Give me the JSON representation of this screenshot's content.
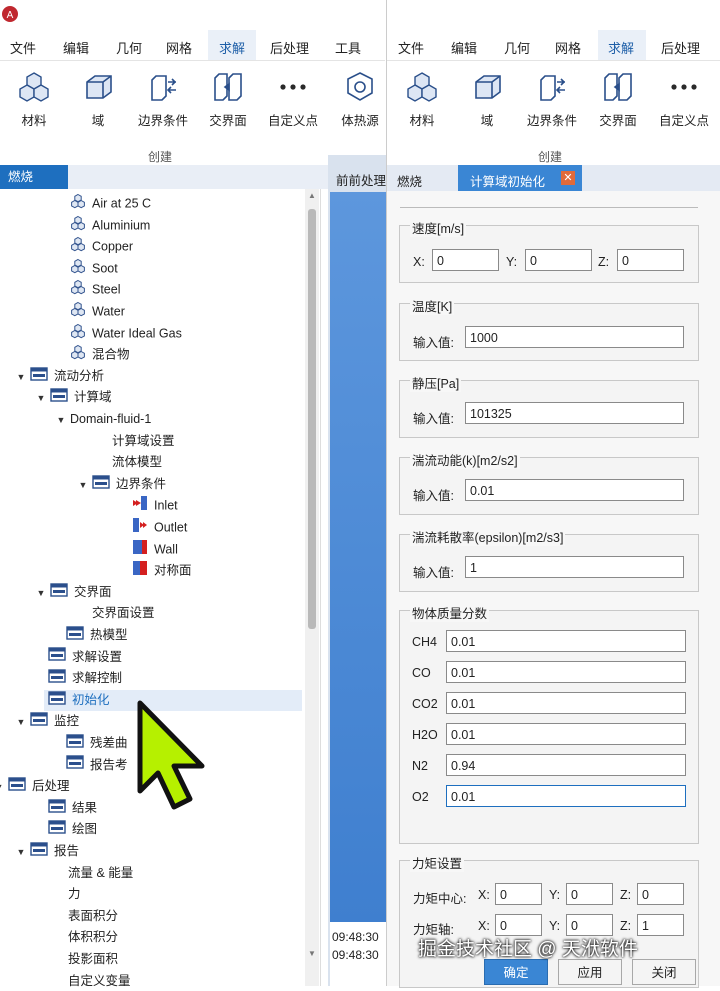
{
  "menu_left": [
    "文件",
    "编辑",
    "几何",
    "网格",
    "求解",
    "后处理",
    "工具"
  ],
  "menu_right": [
    "文件",
    "编辑",
    "几何",
    "网格",
    "求解",
    "后处理"
  ],
  "ribbon_left": [
    {
      "label": "材料",
      "icon": "materials-icon"
    },
    {
      "label": "域",
      "icon": "domain-icon"
    },
    {
      "label": "边界条件",
      "icon": "boundary-condition-icon"
    },
    {
      "label": "交界面",
      "icon": "interface-icon"
    },
    {
      "label": "自定义点",
      "icon": "custom-point-icon"
    },
    {
      "label": "体热源",
      "icon": "heat-source-icon"
    }
  ],
  "ribbon_right": [
    {
      "label": "材料",
      "icon": "materials-icon"
    },
    {
      "label": "域",
      "icon": "domain-icon"
    },
    {
      "label": "边界条件",
      "icon": "boundary-condition-icon"
    },
    {
      "label": "交界面",
      "icon": "interface-icon"
    },
    {
      "label": "自定义点",
      "icon": "custom-point-icon"
    }
  ],
  "group_label": "创建",
  "left_panel_tab": "燃烧",
  "middle_tab": "前前处理",
  "right_tabs": [
    "燃烧",
    "计算域初始化"
  ],
  "tree": [
    {
      "label": "Air at 25 C",
      "indent": 70,
      "icon": "material"
    },
    {
      "label": "Aluminium",
      "indent": 70,
      "icon": "material"
    },
    {
      "label": "Copper",
      "indent": 70,
      "icon": "material"
    },
    {
      "label": "Soot",
      "indent": 70,
      "icon": "material"
    },
    {
      "label": "Steel",
      "indent": 70,
      "icon": "material"
    },
    {
      "label": "Water",
      "indent": 70,
      "icon": "material"
    },
    {
      "label": "Water Ideal Gas",
      "indent": 70,
      "icon": "material"
    },
    {
      "label": "混合物",
      "indent": 70,
      "icon": "material"
    },
    {
      "label": "流动分析",
      "indent": 30,
      "icon": "folder",
      "arrow": "▼"
    },
    {
      "label": "计算域",
      "indent": 50,
      "icon": "folder",
      "arrow": "▼"
    },
    {
      "label": "Domain-fluid-1",
      "indent": 70,
      "icon": "none",
      "arrow": "▼"
    },
    {
      "label": "计算域设置",
      "indent": 112,
      "icon": "none"
    },
    {
      "label": "流体模型",
      "indent": 112,
      "icon": "none"
    },
    {
      "label": "边界条件",
      "indent": 92,
      "icon": "folder",
      "arrow": "▼"
    },
    {
      "label": "Inlet",
      "indent": 132,
      "icon": "inlet"
    },
    {
      "label": "Outlet",
      "indent": 132,
      "icon": "outlet"
    },
    {
      "label": "Wall",
      "indent": 132,
      "icon": "wall"
    },
    {
      "label": "对称面",
      "indent": 132,
      "icon": "symmetry"
    },
    {
      "label": "交界面",
      "indent": 50,
      "icon": "folder",
      "arrow": "▼"
    },
    {
      "label": "交界面设置",
      "indent": 92,
      "icon": "none"
    },
    {
      "label": "热模型",
      "indent": 66,
      "icon": "folder"
    },
    {
      "label": "求解设置",
      "indent": 48,
      "icon": "folder"
    },
    {
      "label": "求解控制",
      "indent": 48,
      "icon": "folder"
    },
    {
      "label": "初始化",
      "indent": 48,
      "icon": "folder",
      "selected": true
    },
    {
      "label": "监控",
      "indent": 30,
      "icon": "folder",
      "arrow": "▼"
    },
    {
      "label": "残差曲",
      "indent": 66,
      "icon": "folder"
    },
    {
      "label": "报告考",
      "indent": 66,
      "icon": "folder"
    },
    {
      "label": "后处理",
      "indent": 8,
      "icon": "folder",
      "arrow": "▼"
    },
    {
      "label": "结果",
      "indent": 48,
      "icon": "folder"
    },
    {
      "label": "绘图",
      "indent": 48,
      "icon": "folder"
    },
    {
      "label": "报告",
      "indent": 30,
      "icon": "folder",
      "arrow": "▼"
    },
    {
      "label": "流量 & 能量",
      "indent": 68,
      "icon": "none"
    },
    {
      "label": "力",
      "indent": 68,
      "icon": "none"
    },
    {
      "label": "表面积分",
      "indent": 68,
      "icon": "none"
    },
    {
      "label": "体积积分",
      "indent": 68,
      "icon": "none"
    },
    {
      "label": "投影面积",
      "indent": 68,
      "icon": "none"
    },
    {
      "label": "自定义变量",
      "indent": 68,
      "icon": "none"
    }
  ],
  "log_lines": [
    "09:48:30",
    "09:48:30"
  ],
  "form": {
    "velocity": {
      "title": "速度[m/s]",
      "x_label": "X:",
      "x": "0",
      "y_label": "Y:",
      "y": "0",
      "z_label": "Z:",
      "z": "0"
    },
    "temperature": {
      "title": "温度[K]",
      "label": "输入值:",
      "value": "1000"
    },
    "static_pressure": {
      "title": "静压[Pa]",
      "label": "输入值:",
      "value": "101325"
    },
    "tke": {
      "title": "湍流动能(k)[m2/s2]",
      "label": "输入值:",
      "value": "0.01"
    },
    "epsilon": {
      "title": "湍流耗散率(epsilon)[m2/s3]",
      "label": "输入值:",
      "value": "1"
    },
    "mass_fractions": {
      "title": "物体质量分数",
      "items": [
        {
          "species": "CH4",
          "value": "0.01"
        },
        {
          "species": "CO",
          "value": "0.01"
        },
        {
          "species": "CO2",
          "value": "0.01"
        },
        {
          "species": "H2O",
          "value": "0.01"
        },
        {
          "species": "N2",
          "value": "0.94"
        },
        {
          "species": "O2",
          "value": "0.01"
        }
      ]
    },
    "moment": {
      "title": "力矩设置",
      "center_label": "力矩中心:",
      "axis_label": "力矩轴:",
      "center": {
        "x": "0",
        "y": "0",
        "z": "0"
      },
      "axis": {
        "x": "0",
        "y": "0",
        "z": "1"
      },
      "x_label": "X:",
      "y_label": "Y:",
      "z_label": "Z:"
    }
  },
  "buttons": {
    "ok": "确定",
    "apply": "应用",
    "close": "关闭"
  },
  "watermark": "掘金技术社区 @ 天洑软件",
  "colors": {
    "accent": "#1e6fbf",
    "tab_active": "#3a86d4",
    "close_x": "#e06a3a",
    "cursor_fill": "#b6f000",
    "blue_area": "#4f8fd8"
  }
}
